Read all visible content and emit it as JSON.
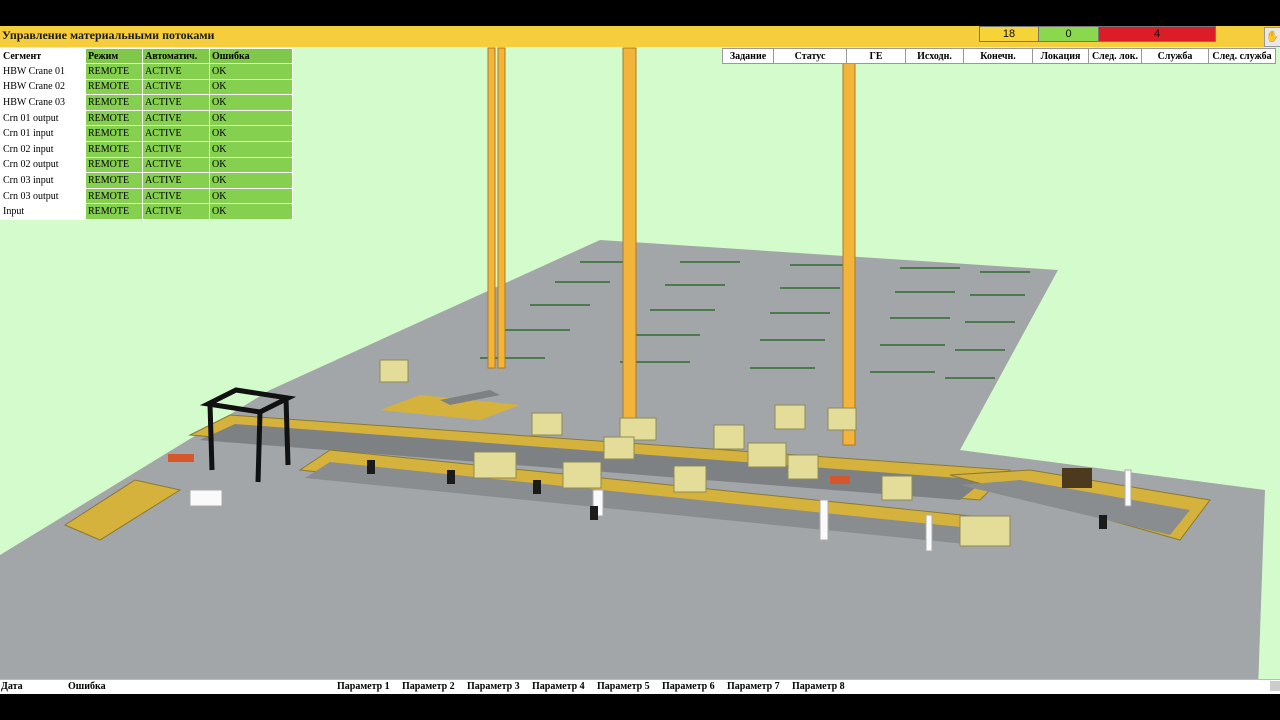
{
  "header": {
    "title": "Управление материальными потоками"
  },
  "counters": {
    "yellow": "18",
    "green": "0",
    "red": "4"
  },
  "segments": {
    "columns": [
      "Сегмент",
      "Режим",
      "Автоматич.",
      "Ошибка"
    ],
    "rows": [
      [
        "HBW Crane 01",
        "REMOTE",
        "ACTIVE",
        "OK"
      ],
      [
        "HBW Crane 02",
        "REMOTE",
        "ACTIVE",
        "OK"
      ],
      [
        "HBW Crane 03",
        "REMOTE",
        "ACTIVE",
        "OK"
      ],
      [
        "Crn 01 output",
        "REMOTE",
        "ACTIVE",
        "OK"
      ],
      [
        "Crn 01 input",
        "REMOTE",
        "ACTIVE",
        "OK"
      ],
      [
        "Crn 02 input",
        "REMOTE",
        "ACTIVE",
        "OK"
      ],
      [
        "Crn 02 output",
        "REMOTE",
        "ACTIVE",
        "OK"
      ],
      [
        "Crn 03 input",
        "REMOTE",
        "ACTIVE",
        "OK"
      ],
      [
        "Crn 03 output",
        "REMOTE",
        "ACTIVE",
        "OK"
      ],
      [
        "Input",
        "REMOTE",
        "ACTIVE",
        "OK"
      ]
    ]
  },
  "tasks": {
    "columns": [
      "Задание",
      "Статус",
      "ГЕ",
      "Исходн.",
      "Конечн.",
      "Локация",
      "След. лок.",
      "Служба",
      "След. служба"
    ]
  },
  "footer": {
    "date_label": "Дата",
    "error_label": "Ошибка",
    "params": [
      "Параметр 1",
      "Параметр 2",
      "Параметр 3",
      "Параметр 4",
      "Параметр 5",
      "Параметр 6",
      "Параметр 7",
      "Параметр 8"
    ]
  },
  "colors": {
    "scene_bg": "#d4fbcc",
    "title_bar": "#f6cd3c",
    "status_green": "#85d04f",
    "alarm_red": "#dc1d27"
  }
}
